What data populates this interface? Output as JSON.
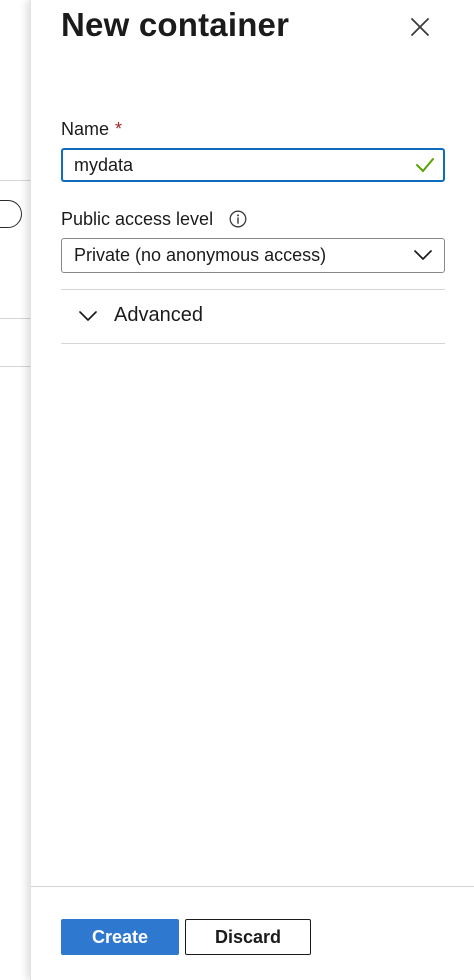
{
  "blade": {
    "title": "New container",
    "close_icon": "close-icon"
  },
  "form": {
    "name": {
      "label": "Name",
      "required_marker": "*",
      "value": "mydata",
      "valid_icon": "check-icon"
    },
    "public_access": {
      "label": "Public access level",
      "info_icon": "info-icon",
      "selected": "Private (no anonymous access)",
      "chevron_icon": "chevron-down-icon"
    },
    "advanced": {
      "label": "Advanced",
      "expanded": false,
      "chevron_icon": "chevron-down-icon"
    }
  },
  "footer": {
    "create_label": "Create",
    "discard_label": "Discard"
  },
  "colors": {
    "primary": "#2f78d0",
    "focus_border": "#0f6cbd",
    "valid": "#57a300",
    "required": "#a4262c"
  }
}
